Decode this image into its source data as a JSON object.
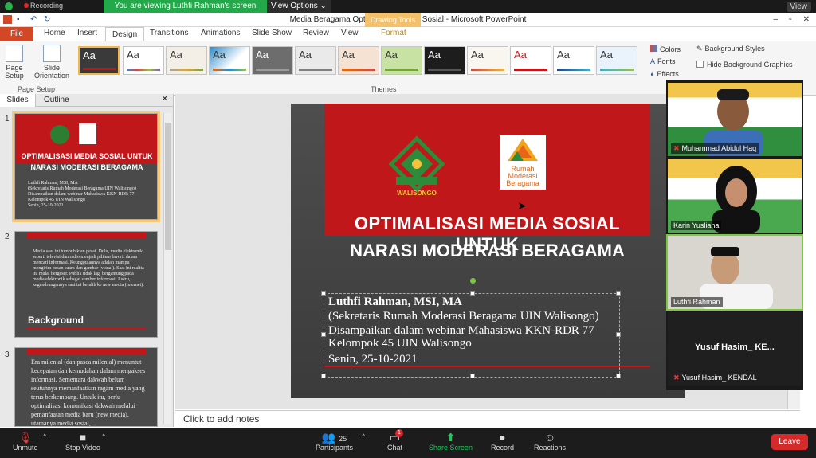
{
  "zoom_top": {
    "recording_label": "Recording",
    "banner": "You are viewing Luthfi Rahman's screen",
    "view_options": "View Options ⌄",
    "view_label": "View"
  },
  "ppt": {
    "window_title": "Media Beragama Optimalisasi Media Sosial - Microsoft PowerPoint",
    "drawing_tools": "Drawing Tools",
    "tabs": [
      "File",
      "Home",
      "Insert",
      "Design",
      "Transitions",
      "Animations",
      "Slide Show",
      "Review",
      "View",
      "Format"
    ],
    "ribbon": {
      "page_setup": "Page Setup",
      "slide_orientation": "Slide Orientation",
      "group_page_setup": "Page Setup",
      "group_themes": "Themes",
      "theme_glyph": "Aa",
      "colors": "Colors",
      "fonts": "Fonts",
      "effects": "Effects",
      "background_styles": "Background Styles",
      "hide_background": "Hide Background Graphics"
    },
    "pane": {
      "tab_slides": "Slides",
      "tab_outline": "Outline",
      "thumb1": {
        "num": "1",
        "title1": "OPTIMALISASI MEDIA SOSIAL UNTUK",
        "title2": "NARASI MODERASI BERAGAMA",
        "text": "Luthfi Rahman, MSI, MA\n(Sekretaris Rumah Moderasi Beragama UIN Walisongo)\nDisampaikan dalam webinar Mahasiswa KKN-RDR 77\nKelompok 45 UIN Walisongo\nSenin, 25-10-2021"
      },
      "thumb2": {
        "num": "2",
        "text": "Media saat ini tumbuh kian pesat. Dulu, media elektronik seperti televisi dan radio menjadi pilihan favorit dalam mencari informasi. Keunggulannya adalah mampu mengirim pesan suara dan gambar (visual). Saat ini realita itu mulai bergeser. Publik tidak lagi bergantung pada media elektronik sebagai sumber informasi. Justru, kegandrungannya saat ini beralih ke new media (internet).",
        "heading": "Background"
      },
      "thumb3": {
        "num": "3",
        "text": "Era milenial (dan pasca milenial) menuntut kecepatan dan kemudahan dalam mengakses informasi. Sementara dakwah belum seutuhnya memanfaatkan ragam media yang terus berkembang. Untuk itu, perlu optimalisasi komunikasi dakwah melalui pemanfaatan media baru (new media), utamanya media sosial,"
      }
    },
    "slide": {
      "ws_logo_text": "WALISONGO",
      "rmb_logo_text": "Rumah\nModerasi\nBeragama",
      "title1": "OPTIMALISASI MEDIA SOSIAL UNTUK",
      "title2": "NARASI MODERASI BERAGAMA",
      "lines": [
        "Luthfi Rahman, MSI, MA",
        "(Sekretaris Rumah Moderasi Beragama UIN Walisongo)",
        "Disampaikan dalam webinar Mahasiswa KKN-RDR 77",
        "Kelompok 45 UIN Walisongo",
        "Senin, 25-10-2021"
      ]
    },
    "notes_placeholder": "Click to add notes"
  },
  "video": {
    "tiles": [
      {
        "name": "Muhammad Abidul Haq"
      },
      {
        "name": "Karin Yusliana"
      },
      {
        "name": "Luthfi Rahman"
      },
      {
        "name": "Yusuf Hasim_ KENDAL",
        "center": "Yusuf  Hasim_  KE..."
      }
    ]
  },
  "zoom_bar": {
    "unmute": "Unmute",
    "stop_video": "Stop Video",
    "participants": "Participants",
    "participant_count": "25",
    "chat": "Chat",
    "chat_badge": "1",
    "share_screen": "Share Screen",
    "record": "Record",
    "reactions": "Reactions",
    "leave": "Leave"
  },
  "colors": {
    "slide_red": "#c0171b",
    "zoom_green": "#23a94a",
    "ppt_file_tab": "#d24726",
    "leave_red": "#d42a2a"
  }
}
